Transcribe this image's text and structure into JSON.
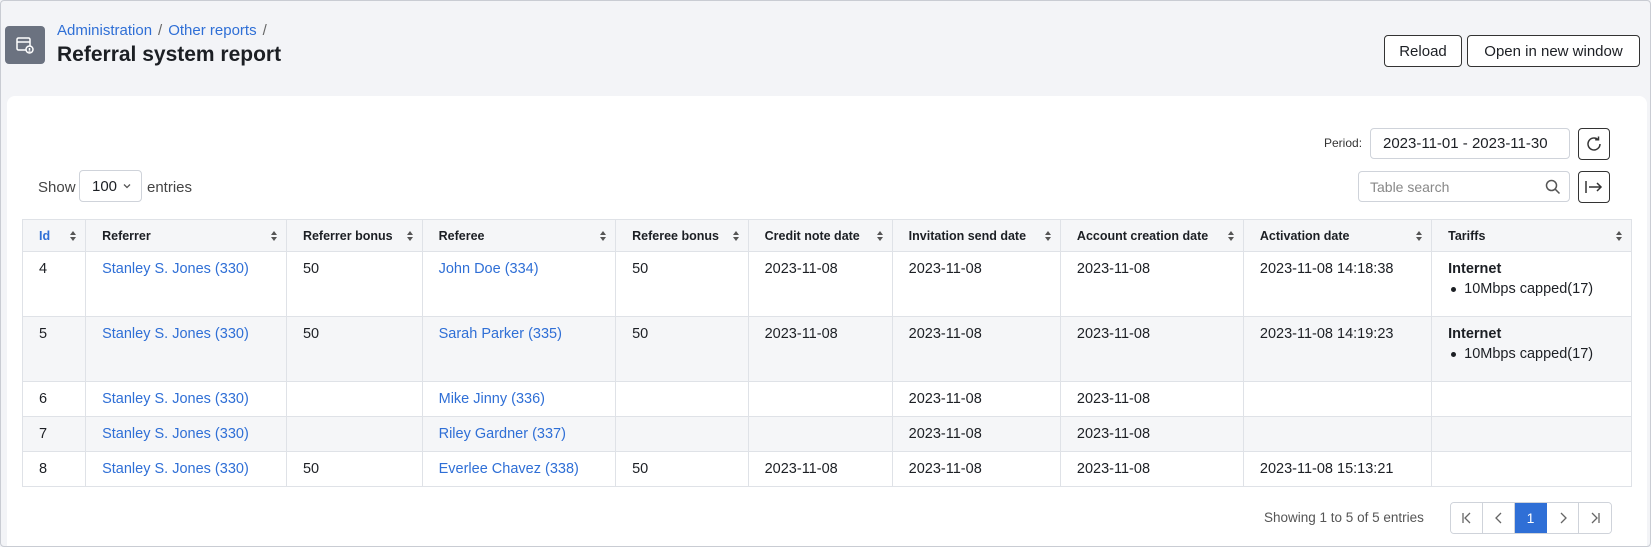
{
  "breadcrumb": {
    "item1": "Administration",
    "sep": "/",
    "item2": "Other reports"
  },
  "page_title": "Referral system report",
  "actions": {
    "reload": "Reload",
    "open_new_window": "Open in new window"
  },
  "filters": {
    "period_label": "Period:",
    "period_value": "2023-11-01 - 2023-11-30",
    "search_placeholder": "Table search",
    "show_label": "Show",
    "entries_value": "100",
    "entries_label": "entries"
  },
  "table": {
    "headers": [
      "Id",
      "Referrer",
      "Referrer bonus",
      "Referee",
      "Referee bonus",
      "Credit note date",
      "Invitation send date",
      "Account creation date",
      "Activation date",
      "Tariffs"
    ],
    "rows": [
      {
        "id": "4",
        "referrer": "Stanley S. Jones (330)",
        "referrer_bonus": "50",
        "referee": "John Doe (334)",
        "referee_bonus": "50",
        "credit_note_date": "2023-11-08",
        "invitation_send_date": "2023-11-08",
        "account_creation_date": "2023-11-08",
        "activation_date": "2023-11-08 14:18:38",
        "tariff_title": "Internet",
        "tariff_item": "10Mbps capped(17)"
      },
      {
        "id": "5",
        "referrer": "Stanley S. Jones (330)",
        "referrer_bonus": "50",
        "referee": "Sarah Parker (335)",
        "referee_bonus": "50",
        "credit_note_date": "2023-11-08",
        "invitation_send_date": "2023-11-08",
        "account_creation_date": "2023-11-08",
        "activation_date": "2023-11-08 14:19:23",
        "tariff_title": "Internet",
        "tariff_item": "10Mbps capped(17)"
      },
      {
        "id": "6",
        "referrer": "Stanley S. Jones (330)",
        "referrer_bonus": "",
        "referee": "Mike Jinny (336)",
        "referee_bonus": "",
        "credit_note_date": "",
        "invitation_send_date": "2023-11-08",
        "account_creation_date": "2023-11-08",
        "activation_date": "",
        "tariff_title": "",
        "tariff_item": ""
      },
      {
        "id": "7",
        "referrer": "Stanley S. Jones (330)",
        "referrer_bonus": "",
        "referee": "Riley Gardner (337)",
        "referee_bonus": "",
        "credit_note_date": "",
        "invitation_send_date": "2023-11-08",
        "account_creation_date": "2023-11-08",
        "activation_date": "",
        "tariff_title": "",
        "tariff_item": ""
      },
      {
        "id": "8",
        "referrer": "Stanley S. Jones (330)",
        "referrer_bonus": "50",
        "referee": "Everlee Chavez (338)",
        "referee_bonus": "50",
        "credit_note_date": "2023-11-08",
        "invitation_send_date": "2023-11-08",
        "account_creation_date": "2023-11-08",
        "activation_date": "2023-11-08 15:13:21",
        "tariff_title": "",
        "tariff_item": ""
      }
    ]
  },
  "footer": {
    "showing": "Showing 1 to 5 of 5 entries",
    "current_page": "1"
  },
  "colors": {
    "link": "#2f6fd6",
    "header_icon_bg": "#6b7280",
    "active_page": "#2f6fd6"
  }
}
